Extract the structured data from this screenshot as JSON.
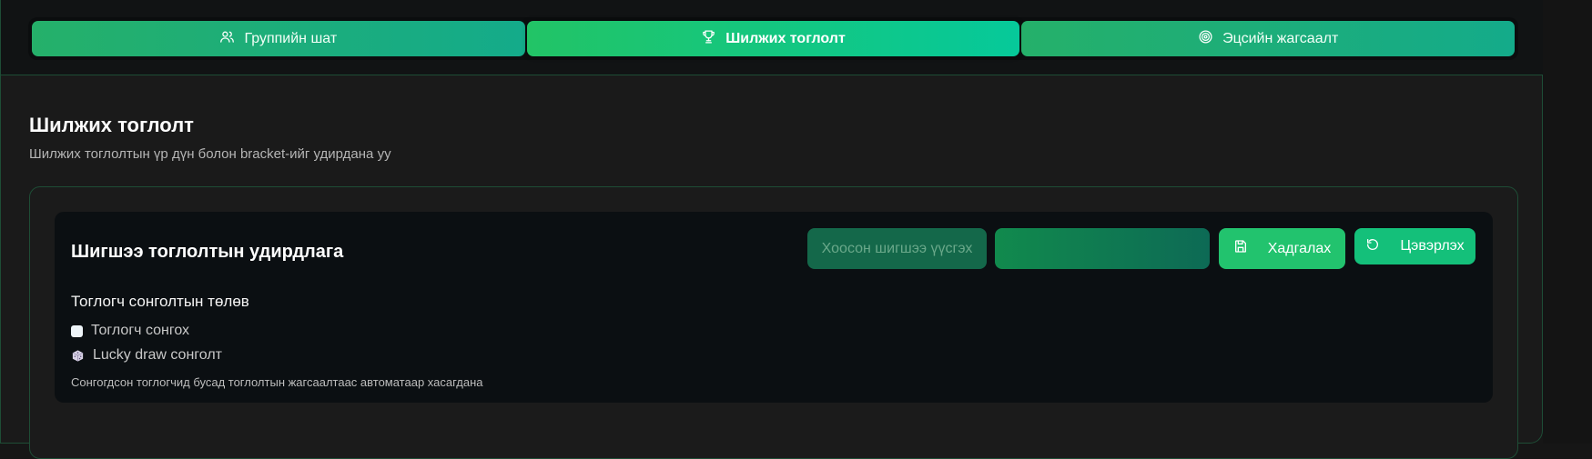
{
  "tabs": [
    {
      "label": "Группийн шат",
      "icon": "users-icon"
    },
    {
      "label": "Шилжих тоглолт",
      "icon": "trophy-icon",
      "active": true
    },
    {
      "label": "Эцсийн жагсаалт",
      "icon": "target-icon"
    }
  ],
  "page": {
    "title": "Шилжих тоглолт",
    "subtitle": "Шилжих тоглолтын үр дүн болон bracket-ийг удирдана уу"
  },
  "panel": {
    "title": "Шигшээ тоглолтын удирдлага",
    "buttons": {
      "create_empty": "Хоосон шигшээ үүсгэх",
      "blank": "",
      "save": "Хадгалах",
      "reset": "Цэвэрлэх"
    },
    "selection": {
      "heading": "Тоглогч сонголтын төлөв",
      "option_select": "Тоглогч сонгох",
      "option_lucky": "Lucky draw сонголт",
      "note": "Сонгогдсон тоглогчид бусад тоглолтын жагсаалтаас автоматаар хасагдана"
    }
  },
  "colors": {
    "accent": "#22c36e",
    "accent_alt": "#06c99a",
    "border": "#1e4d36",
    "background": "#1a1a1a"
  }
}
